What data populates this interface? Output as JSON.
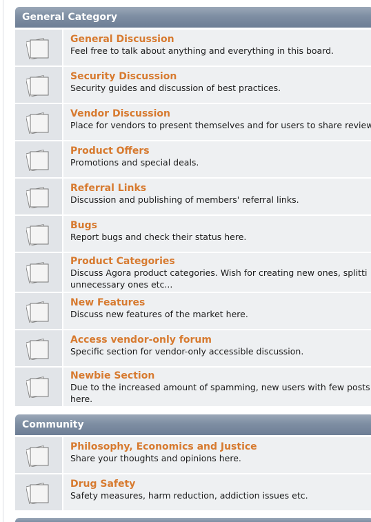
{
  "categories": [
    {
      "name": "General Category",
      "boards": [
        {
          "title": "General Discussion",
          "desc": "Feel free to talk about anything and everything in this board."
        },
        {
          "title": "Security Discussion",
          "desc": "Security guides and discussion of best practices."
        },
        {
          "title": "Vendor Discussion",
          "desc": "Place for vendors to present themselves and for users to share review"
        },
        {
          "title": "Product Offers",
          "desc": "Promotions and special deals."
        },
        {
          "title": "Referral Links",
          "desc": "Discussion and publishing of members' referral links."
        },
        {
          "title": "Bugs",
          "desc": "Report bugs and check their status here."
        },
        {
          "title": "Product Categories",
          "desc": "Discuss Agora product categories. Wish for creating new ones, splitti\nunnecessary ones etc..."
        },
        {
          "title": "New Features",
          "desc": "Discuss new features of the market here."
        },
        {
          "title": "Access vendor-only forum",
          "desc": "Specific section for vendor-only accessible discussion."
        },
        {
          "title": "Newbie Section",
          "desc": "Due to the increased amount of spamming, new users with few posts\nhere."
        }
      ]
    },
    {
      "name": "Community",
      "boards": [
        {
          "title": "Philosophy, Economics and Justice",
          "desc": "Share your thoughts and opinions here."
        },
        {
          "title": "Drug Safety",
          "desc": "Safety measures, harm reduction, addiction issues etc."
        }
      ]
    }
  ],
  "icons": {
    "board": "board-pages-icon"
  },
  "colors": {
    "header": "#7e8ea3",
    "title": "#d77a2f",
    "row": "#eef0f2",
    "iconCell": "#e1e4e8"
  }
}
